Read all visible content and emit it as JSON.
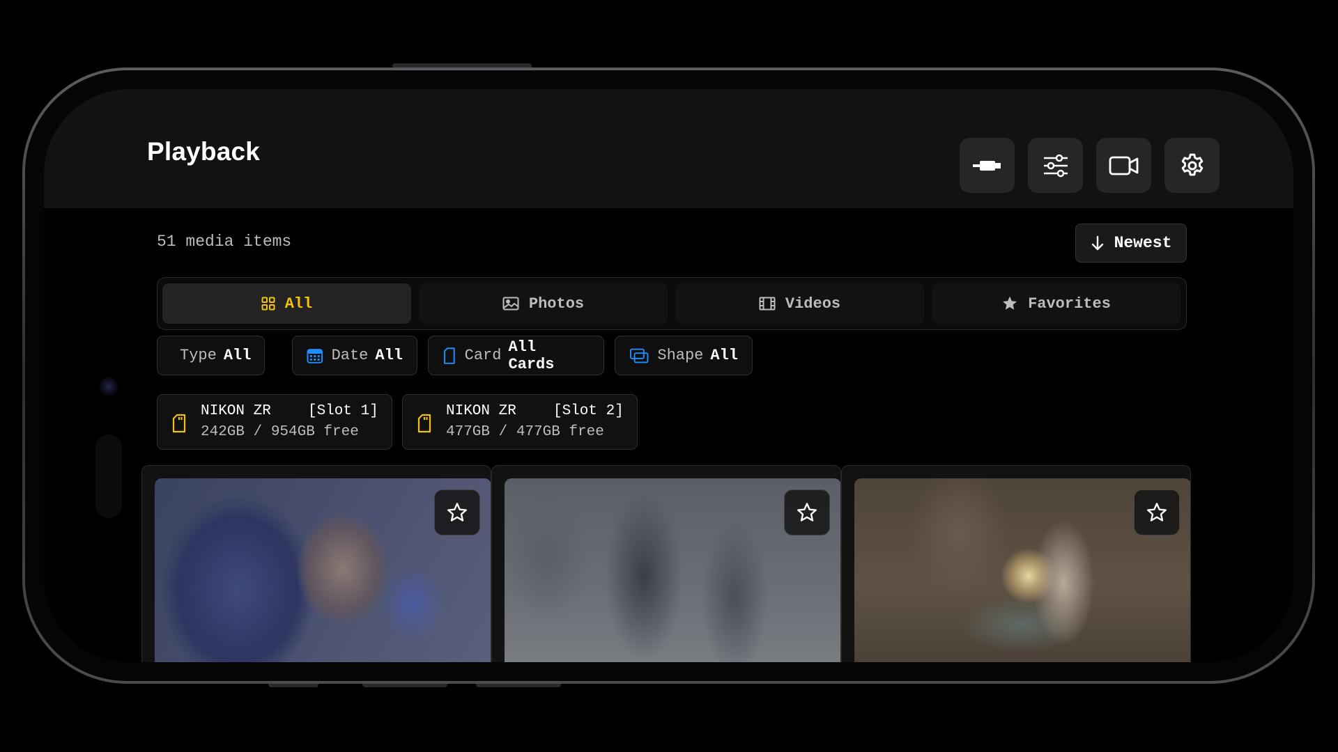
{
  "header": {
    "title": "Playback",
    "buttons": [
      "usb-cable-icon",
      "sliders-icon",
      "video-camera-icon",
      "gear-icon"
    ]
  },
  "summary": {
    "count_text": "51 media items",
    "sort_label": "Newest",
    "sort_icon": "arrow-down-icon"
  },
  "tabs": [
    {
      "label": "All",
      "icon": "grid-icon",
      "active": true
    },
    {
      "label": "Photos",
      "icon": "image-icon",
      "active": false
    },
    {
      "label": "Videos",
      "icon": "film-icon",
      "active": false
    },
    {
      "label": "Favorites",
      "icon": "star-icon",
      "active": false
    }
  ],
  "filters": [
    {
      "key": "Type",
      "value": "All",
      "icon": "files-icon"
    },
    {
      "key": "Date",
      "value": "All",
      "icon": "calendar-icon"
    },
    {
      "key": "Card",
      "value": "All Cards",
      "icon": "sd-card-icon"
    },
    {
      "key": "Shape",
      "value": "All",
      "icon": "overlap-squares-icon"
    }
  ],
  "cards": [
    {
      "camera": "NIKON ZR",
      "slot": "[Slot 1]",
      "storage": "242GB / 954GB free"
    },
    {
      "camera": "NIKON ZR",
      "slot": "[Slot 2]",
      "storage": "477GB / 477GB free"
    }
  ],
  "media": [
    {
      "scene": "two men talking in a crowd",
      "favorite": false
    },
    {
      "scene": "blurred pedestrians walking",
      "favorite": false
    },
    {
      "scene": "woman seated in a cafe",
      "favorite": false
    }
  ],
  "colors": {
    "accent": "#f4c20d",
    "blue": "#1f8fff",
    "background": "#000000",
    "header": "#121212"
  }
}
